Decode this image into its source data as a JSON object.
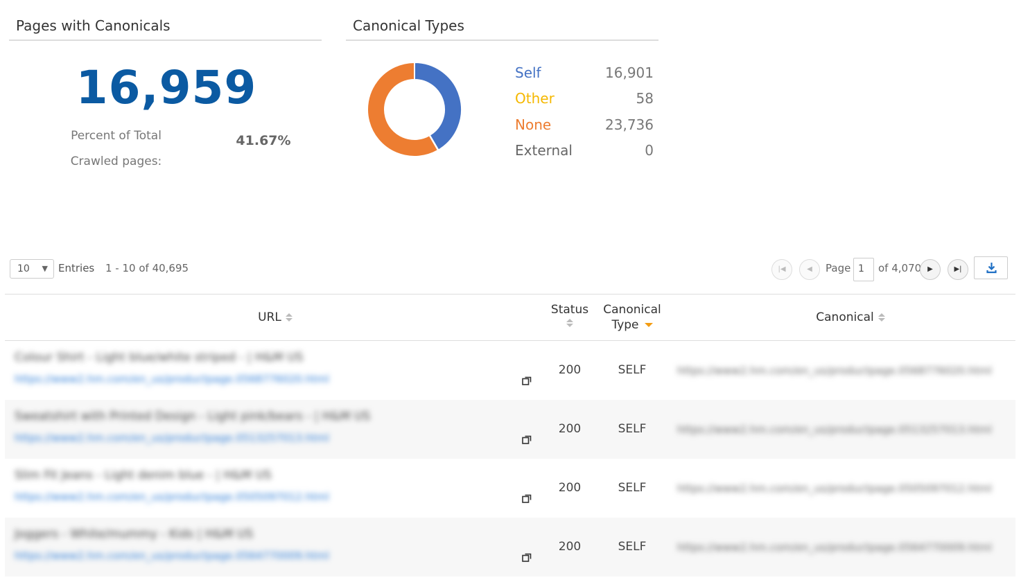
{
  "pages_with_canonicals": {
    "title": "Pages with Canonicals",
    "count": "16,959",
    "pct_label": "Percent of Total Crawled pages:",
    "pct_value": "41.67%"
  },
  "canonical_types": {
    "title": "Canonical Types",
    "items": [
      {
        "label": "Self",
        "value": "16,901",
        "count": 16901,
        "color": "#4472c4"
      },
      {
        "label": "Other",
        "value": "58",
        "count": 58,
        "color": "#f5b800"
      },
      {
        "label": "None",
        "value": "23,736",
        "count": 23736,
        "color": "#ed7d31"
      },
      {
        "label": "External",
        "value": "0",
        "count": 0,
        "color": "#666666"
      }
    ]
  },
  "toolbar": {
    "entries_value": "10",
    "entries_label": "Entries",
    "range_label": "1 - 10 of 40,695",
    "page_label": "Page",
    "page_value": "1",
    "page_of": "of 4,070"
  },
  "table": {
    "columns": {
      "url": "URL",
      "status": "Status",
      "canonical_type_line1": "Canonical",
      "canonical_type_line2": "Type",
      "canonical": "Canonical"
    },
    "rows": [
      {
        "title": "Colour Shirt - Light blue/white striped - | H&M US",
        "url": "https://www2.hm.com/en_us/productpage.0568776020.html",
        "status": "200",
        "type": "SELF",
        "canonical": "https://www2.hm.com/en_us/productpage.0568776020.html"
      },
      {
        "title": "Sweatshirt with Printed Design - Light pink/bears - | H&M US",
        "url": "https://www2.hm.com/en_us/productpage.0513257013.html",
        "status": "200",
        "type": "SELF",
        "canonical": "https://www2.hm.com/en_us/productpage.0513257013.html"
      },
      {
        "title": "Slim Fit Jeans - Light denim blue - | H&M US",
        "url": "https://www2.hm.com/en_us/productpage.0505097012.html",
        "status": "200",
        "type": "SELF",
        "canonical": "https://www2.hm.com/en_us/productpage.0505097012.html"
      },
      {
        "title": "Joggers - White/mummy - Kids | H&M US",
        "url": "https://www2.hm.com/en_us/productpage.0564770009.html",
        "status": "200",
        "type": "SELF",
        "canonical": "https://www2.hm.com/en_us/productpage.0564770009.html"
      }
    ]
  }
}
